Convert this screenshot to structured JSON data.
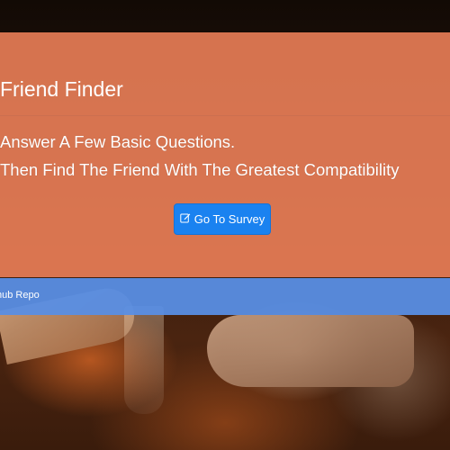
{
  "header": {
    "title": "Friend Finder",
    "lead_line1": "Answer A Few Basic Questions.",
    "lead_line2": "Then Find The Friend With The Greatest Compatibility"
  },
  "survey_button": {
    "label": "Go To Survey",
    "icon": "edit-icon",
    "color": "#1a82f0"
  },
  "footer": {
    "link_label": "hub Repo",
    "color": "#588ee4"
  },
  "colors": {
    "jumbotron": "#f0825a"
  }
}
